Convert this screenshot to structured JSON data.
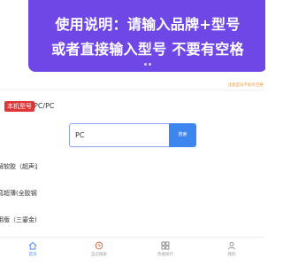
{
  "banner": {
    "line1": "使用说明：请输入品牌+型号",
    "line2": "或者直接输入型号 不要有空格",
    "color": "#6f47e6"
  },
  "notice": "注意型号不能有空格",
  "current_model": {
    "tag": "本机型号",
    "value": "PC/PC"
  },
  "search": {
    "value": "PC",
    "button_label": "搜索",
    "button_color": "#3d86f0"
  },
  "results": [
    "方解软胶（超声波",
    "热弯超薄(全胶钢化",
    "通用版（三鎏金)"
  ],
  "tabbar": {
    "items": [
      {
        "label": "首页",
        "icon": "home-icon",
        "active": true
      },
      {
        "label": "自己搜索",
        "icon": "clock-icon",
        "active": false
      },
      {
        "label": "热搜排行",
        "icon": "grid-icon",
        "active": false
      },
      {
        "label": "我的",
        "icon": "user-icon",
        "active": false
      }
    ]
  }
}
